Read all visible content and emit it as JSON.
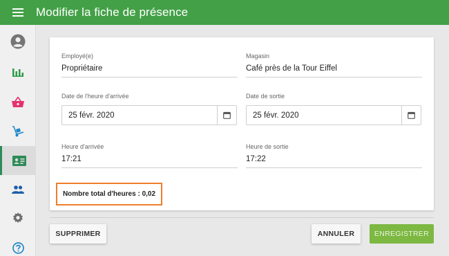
{
  "app": {
    "title": "Modifier la fiche de présence",
    "accent_color": "#43a047"
  },
  "sidebar": {
    "items": [
      {
        "icon": "account-icon",
        "active": false
      },
      {
        "icon": "bar-chart-icon",
        "active": false
      },
      {
        "icon": "basket-icon",
        "active": false
      },
      {
        "icon": "hand-truck-icon",
        "active": false
      },
      {
        "icon": "id-card-icon",
        "active": true
      },
      {
        "icon": "people-icon",
        "active": false
      },
      {
        "icon": "gear-icon",
        "active": false
      },
      {
        "icon": "help-icon",
        "active": false
      }
    ]
  },
  "form": {
    "employee": {
      "label": "Employé(e)",
      "value": "Propriétaire"
    },
    "store": {
      "label": "Magasin",
      "value": "Café près de la Tour Eiffel"
    },
    "arrival_date": {
      "label": "Date de l'heure d'arrivée",
      "value": "25 févr. 2020"
    },
    "exit_date": {
      "label": "Date de sortie",
      "value": "25 févr. 2020"
    },
    "arrival_time": {
      "label": "Heure d'arrivée",
      "value": "17:21"
    },
    "exit_time": {
      "label": "Heure de sortie",
      "value": "17:22"
    },
    "total_hours": "Nombre total d'heures : 0,02"
  },
  "actions": {
    "delete_label": "SUPPRIMER",
    "cancel_label": "ANNULER",
    "save_label": "ENREGISTRER"
  }
}
